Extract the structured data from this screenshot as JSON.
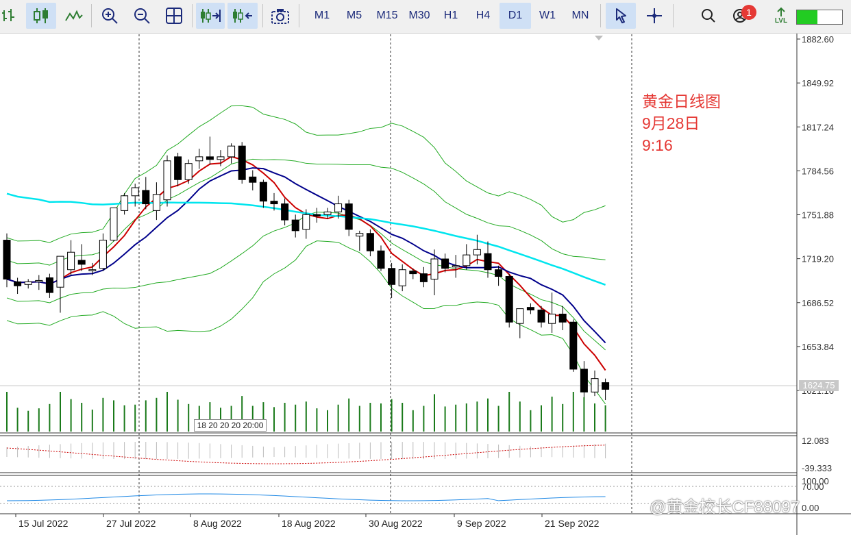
{
  "toolbar": {
    "timeframes": [
      "M1",
      "M5",
      "M15",
      "M30",
      "H1",
      "H4",
      "D1",
      "W1",
      "MN"
    ],
    "active_timeframe": "D1",
    "notification_count": "1",
    "lvl_label": "LVL"
  },
  "annotation": {
    "line1": "黄金日线图",
    "line2": "9月28日",
    "line3": "9:16"
  },
  "watermark": "@黄金校长CF88097",
  "price_axis": [
    "1882.60",
    "1849.92",
    "1817.24",
    "1784.56",
    "1751.88",
    "1719.20",
    "1686.52",
    "1653.84",
    "1621.16"
  ],
  "current_price": "1624.75",
  "osc1_axis": [
    "12.083",
    "-39.333"
  ],
  "osc2_axis": [
    "100.00",
    "70.00",
    "0.00"
  ],
  "dates": [
    "15 Jul 2022",
    "27 Jul 2022",
    "8 Aug 2022",
    "18 Aug 2022",
    "30 Aug 2022",
    "9 Sep 2022",
    "21 Sep 2022"
  ],
  "volume_tag": "18 20 20 20 20:00",
  "colors": {
    "ma_fast": "#cc0000",
    "ma_mid": "#00008b",
    "ma_slow": "#00e5ee",
    "bands": "#22aa22",
    "volume": "#1a7a1a",
    "rsi": "#1e88e5",
    "osc": "#cc0000"
  },
  "chart_data": {
    "type": "candlestick",
    "price_range": [
      1621.16,
      1882.6
    ],
    "candles": [
      [
        1733,
        1738,
        1698,
        1704
      ],
      [
        1702,
        1705,
        1693,
        1699
      ],
      [
        1700,
        1704,
        1697,
        1702
      ],
      [
        1702,
        1707,
        1696,
        1703
      ],
      [
        1705,
        1708,
        1690,
        1694
      ],
      [
        1698,
        1718,
        1679,
        1721
      ],
      [
        1711,
        1733,
        1707,
        1724
      ],
      [
        1718,
        1730,
        1710,
        1715
      ],
      [
        1711,
        1716,
        1707,
        1711
      ],
      [
        1712,
        1738,
        1710,
        1733
      ],
      [
        1733,
        1756,
        1732,
        1757
      ],
      [
        1755,
        1768,
        1752,
        1766
      ],
      [
        1766,
        1775,
        1758,
        1772
      ],
      [
        1770,
        1780,
        1756,
        1760
      ],
      [
        1755,
        1776,
        1748,
        1767
      ],
      [
        1763,
        1796,
        1758,
        1792
      ],
      [
        1795,
        1798,
        1773,
        1778
      ],
      [
        1778,
        1793,
        1775,
        1790
      ],
      [
        1792,
        1801,
        1786,
        1795
      ],
      [
        1795,
        1810,
        1789,
        1793
      ],
      [
        1793,
        1800,
        1788,
        1795
      ],
      [
        1795,
        1805,
        1790,
        1803
      ],
      [
        1803,
        1806,
        1775,
        1778
      ],
      [
        1780,
        1785,
        1770,
        1776
      ],
      [
        1776,
        1778,
        1757,
        1762
      ],
      [
        1762,
        1768,
        1755,
        1760
      ],
      [
        1760,
        1764,
        1744,
        1748
      ],
      [
        1748,
        1752,
        1735,
        1740
      ],
      [
        1741,
        1756,
        1734,
        1752
      ],
      [
        1752,
        1757,
        1746,
        1751
      ],
      [
        1752,
        1757,
        1749,
        1754
      ],
      [
        1754,
        1766,
        1749,
        1760
      ],
      [
        1760,
        1763,
        1736,
        1741
      ],
      [
        1736,
        1740,
        1725,
        1738
      ],
      [
        1738,
        1741,
        1721,
        1725
      ],
      [
        1725,
        1729,
        1710,
        1712
      ],
      [
        1712,
        1716,
        1690,
        1700
      ],
      [
        1699,
        1715,
        1695,
        1711
      ],
      [
        1710,
        1712,
        1704,
        1708
      ],
      [
        1708,
        1713,
        1698,
        1702
      ],
      [
        1704,
        1726,
        1692,
        1719
      ],
      [
        1719,
        1723,
        1709,
        1712
      ],
      [
        1713,
        1722,
        1705,
        1714
      ],
      [
        1714,
        1730,
        1711,
        1722
      ],
      [
        1722,
        1737,
        1715,
        1726
      ],
      [
        1723,
        1732,
        1705,
        1711
      ],
      [
        1711,
        1714,
        1699,
        1706
      ],
      [
        1706,
        1708,
        1668,
        1672
      ],
      [
        1671,
        1682,
        1660,
        1682
      ],
      [
        1683,
        1686,
        1678,
        1681
      ],
      [
        1681,
        1684,
        1668,
        1672
      ],
      [
        1671,
        1694,
        1664,
        1678
      ],
      [
        1678,
        1684,
        1666,
        1672
      ],
      [
        1672,
        1674,
        1635,
        1637
      ],
      [
        1637,
        1643,
        1614,
        1620
      ],
      [
        1620,
        1636,
        1617,
        1630
      ],
      [
        1627,
        1630,
        1614,
        1622
      ]
    ]
  }
}
